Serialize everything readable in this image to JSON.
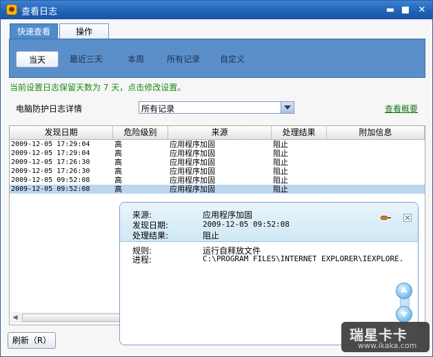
{
  "window": {
    "title": "查看日志",
    "min_glyph": "▬",
    "max_glyph": "■",
    "close_glyph": "✕"
  },
  "tabs": [
    {
      "label": "快速查看",
      "active": true
    },
    {
      "label": "操作",
      "active": false
    }
  ],
  "filters": [
    {
      "label": "当天",
      "active": true
    },
    {
      "label": "最近三天",
      "active": false
    },
    {
      "label": "本周",
      "active": false
    },
    {
      "label": "所有记录",
      "active": false
    },
    {
      "label": "自定义",
      "active": false
    }
  ],
  "hint": "当前设置日志保留天数为 7 天，点击修改设置。",
  "detail": {
    "label": "电脑防护日志详情",
    "select_value": "所有记录",
    "overview_link": "查看概要"
  },
  "table": {
    "columns": [
      "发现日期",
      "危险级别",
      "来源",
      "处理结果",
      "附加信息"
    ],
    "rows": [
      {
        "date": "2009-12-05 17:29:04",
        "level": "高",
        "source": "应用程序加固",
        "result": "阻止",
        "extra": ""
      },
      {
        "date": "2009-12-05 17:29:04",
        "level": "高",
        "source": "应用程序加固",
        "result": "阻止",
        "extra": ""
      },
      {
        "date": "2009-12-05 17:26:30",
        "level": "高",
        "source": "应用程序加固",
        "result": "阻止",
        "extra": ""
      },
      {
        "date": "2009-12-05 17:26:30",
        "level": "高",
        "source": "应用程序加固",
        "result": "阻止",
        "extra": ""
      },
      {
        "date": "2009-12-05 09:52:08",
        "level": "高",
        "source": "应用程序加固",
        "result": "阻止",
        "extra": ""
      },
      {
        "date": "2009-12-05 09:52:08",
        "level": "高",
        "source": "应用程序加固",
        "result": "阻止",
        "extra": ""
      }
    ],
    "selected_row": 5
  },
  "popup": {
    "source_key": "来源:",
    "source_val": "应用程序加固",
    "date_key": "发现日期:",
    "date_val": "2009-12-05 09:52:08",
    "result_key": "处理结果:",
    "result_val": "阻止",
    "rule_key": "规则:",
    "rule_val": "运行自释放文件",
    "process_key": "进程:",
    "process_val": "C:\\PROGRAM FILES\\INTERNET EXPLORER\\IEXPLORE.",
    "close_glyph": "✕"
  },
  "footer": {
    "refresh_label": "刷新（R）"
  },
  "watermark": {
    "logo": "瑞星卡卡",
    "url": "www.ikaka.com"
  },
  "colors": {
    "titlebar": "#1f60b6",
    "panel": "#5a8fca",
    "hint": "#1a8a1a",
    "selected_row": "#bcd6ef"
  }
}
